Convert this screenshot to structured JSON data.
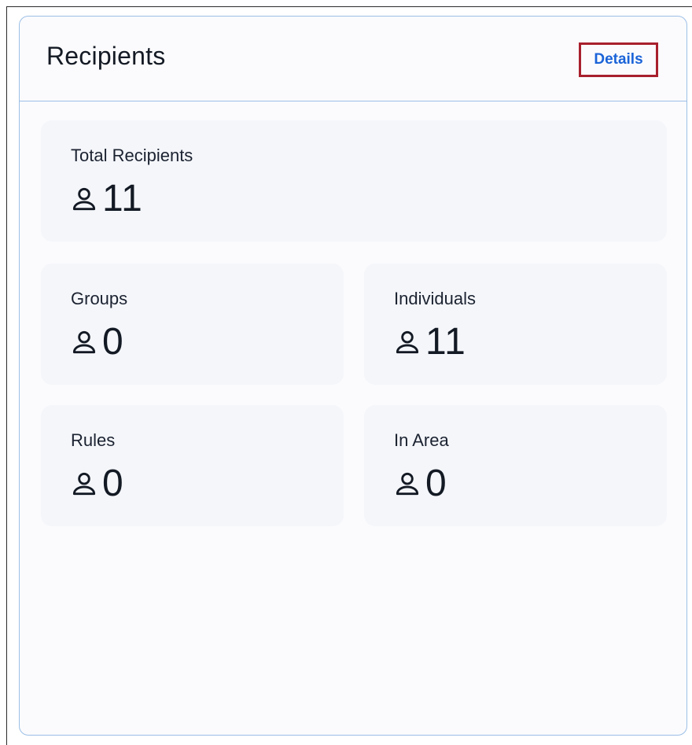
{
  "card": {
    "title": "Recipients",
    "details_label": "Details"
  },
  "stats": {
    "total": {
      "label": "Total Recipients",
      "value": "11",
      "icon": "person-icon"
    },
    "groups": {
      "label": "Groups",
      "value": "0",
      "icon": "person-icon"
    },
    "individuals": {
      "label": "Individuals",
      "value": "11",
      "icon": "person-icon"
    },
    "rules": {
      "label": "Rules",
      "value": "0",
      "icon": "person-icon"
    },
    "in_area": {
      "label": "In Area",
      "value": "0",
      "icon": "person-icon"
    }
  },
  "colors": {
    "accent": "#1a63d8",
    "highlight_border": "#a8202d",
    "card_border": "#9bbfe6",
    "tile_background": "#f4f6fa"
  }
}
